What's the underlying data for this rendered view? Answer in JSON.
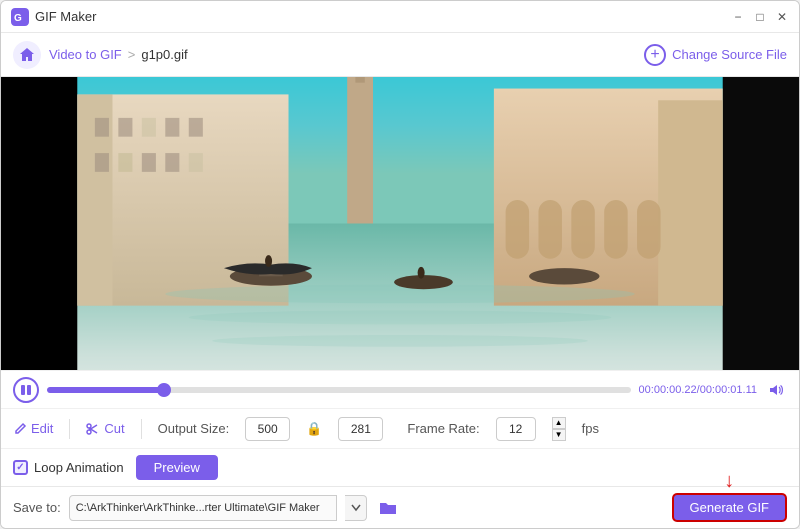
{
  "titleBar": {
    "appName": "GIF Maker",
    "minimize": "−",
    "maximize": "□",
    "close": "✕"
  },
  "navBar": {
    "breadcrumb": {
      "home": "",
      "link": "Video to GIF",
      "sep": ">",
      "current": "g1p0.gif"
    },
    "changeSourceBtn": "Change Source File"
  },
  "controls": {
    "playIcon": "⏸",
    "timeDisplay": "00:00:00.22/00:00:01.11",
    "progressPercent": 20,
    "volumeIcon": "🔊"
  },
  "editBar": {
    "editLabel": "Edit",
    "cutLabel": "Cut",
    "outputSizeLabel": "Output Size:",
    "width": "500",
    "height": "281",
    "frameRateLabel": "Frame Rate:",
    "frameRate": "12",
    "fpsUnit": "fps"
  },
  "optionsBar": {
    "loopLabel": "Loop Animation",
    "previewLabel": "Preview"
  },
  "saveBar": {
    "saveLabel": "Save to:",
    "savePath": "C:\\ArkThinker\\ArkThinke...rter Ultimate\\GIF Maker",
    "generateLabel": "Generate GIF"
  }
}
